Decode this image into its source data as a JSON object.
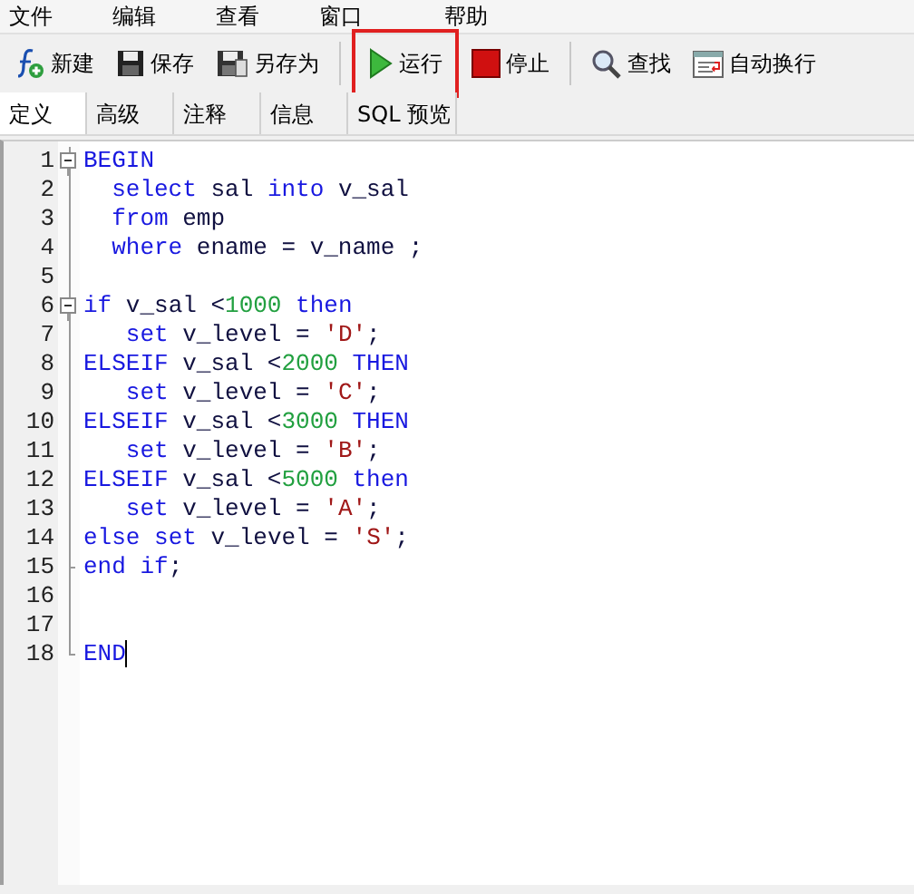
{
  "menu": [
    "文件",
    "编辑",
    "查看",
    "窗口",
    "帮助"
  ],
  "toolbar": {
    "groups": [
      [
        {
          "label": "新建",
          "kind": "new",
          "highlighted": false
        },
        {
          "label": "保存",
          "kind": "save",
          "highlighted": false
        },
        {
          "label": "另存为",
          "kind": "saveas",
          "highlighted": false
        }
      ],
      [
        {
          "label": "运行",
          "kind": "run",
          "highlighted": true
        },
        {
          "label": "停止",
          "kind": "stop",
          "highlighted": false
        }
      ],
      [
        {
          "label": "查找",
          "kind": "search",
          "highlighted": false
        },
        {
          "label": "自动换行",
          "kind": "wrap",
          "highlighted": false
        }
      ]
    ]
  },
  "tabs": [
    {
      "label": "定义",
      "selected": true
    },
    {
      "label": "高级",
      "selected": false
    },
    {
      "label": "注释",
      "selected": false
    },
    {
      "label": "信息",
      "selected": false
    },
    {
      "label": "SQL 预览",
      "selected": false
    }
  ],
  "editor": {
    "lines": [
      {
        "number": "1",
        "kind": "start",
        "tokens": [
          {
            "kind": "kw",
            "text": "BEGIN"
          }
        ]
      },
      {
        "number": "2",
        "kind": "body",
        "tokens": [
          {
            "kind": "kw",
            "text": "  select"
          },
          {
            "kind": "plain",
            "text": " sal "
          },
          {
            "kind": "kw",
            "text": "into"
          },
          {
            "kind": "plain",
            "text": " v_sal"
          }
        ]
      },
      {
        "number": "3",
        "kind": "body",
        "tokens": [
          {
            "kind": "kw",
            "text": "  from"
          },
          {
            "kind": "plain",
            "text": " emp"
          }
        ]
      },
      {
        "number": "4",
        "kind": "body",
        "tokens": [
          {
            "kind": "kw",
            "text": "  where"
          },
          {
            "kind": "plain",
            "text": " ename = v_name ;"
          }
        ]
      },
      {
        "number": "5",
        "kind": "body"
      },
      {
        "number": "6",
        "kind": "start",
        "tokens": [
          {
            "kind": "kw",
            "text": "if"
          },
          {
            "kind": "plain",
            "text": " v_sal <"
          },
          {
            "kind": "num",
            "text": "1000"
          },
          {
            "kind": "kw",
            "text": " then"
          }
        ]
      },
      {
        "number": "7",
        "kind": "body",
        "tokens": [
          {
            "kind": "kw",
            "text": "   set"
          },
          {
            "kind": "plain",
            "text": " v_level = "
          },
          {
            "kind": "str",
            "text": "'D'"
          },
          {
            "kind": "plain",
            "text": ";"
          }
        ]
      },
      {
        "number": "8",
        "kind": "body",
        "tokens": [
          {
            "kind": "kw",
            "text": "ELSEIF"
          },
          {
            "kind": "plain",
            "text": " v_sal <"
          },
          {
            "kind": "num",
            "text": "2000"
          },
          {
            "kind": "kw",
            "text": " THEN"
          }
        ]
      },
      {
        "number": "9",
        "kind": "body",
        "tokens": [
          {
            "kind": "kw",
            "text": "   set"
          },
          {
            "kind": "plain",
            "text": " v_level = "
          },
          {
            "kind": "str",
            "text": "'C'"
          },
          {
            "kind": "plain",
            "text": ";"
          }
        ]
      },
      {
        "number": "10",
        "kind": "body",
        "tokens": [
          {
            "kind": "kw",
            "text": "ELSEIF"
          },
          {
            "kind": "plain",
            "text": " v_sal <"
          },
          {
            "kind": "num",
            "text": "3000"
          },
          {
            "kind": "kw",
            "text": " THEN"
          }
        ]
      },
      {
        "number": "11",
        "kind": "body",
        "tokens": [
          {
            "kind": "kw",
            "text": "   set"
          },
          {
            "kind": "plain",
            "text": " v_level = "
          },
          {
            "kind": "str",
            "text": "'B'"
          },
          {
            "kind": "plain",
            "text": ";"
          }
        ]
      },
      {
        "number": "12",
        "kind": "body",
        "tokens": [
          {
            "kind": "kw",
            "text": "ELSEIF"
          },
          {
            "kind": "plain",
            "text": " v_sal <"
          },
          {
            "kind": "num",
            "text": "5000"
          },
          {
            "kind": "kw",
            "text": " then"
          }
        ]
      },
      {
        "number": "13",
        "kind": "body",
        "tokens": [
          {
            "kind": "kw",
            "text": "   set"
          },
          {
            "kind": "plain",
            "text": " v_level = "
          },
          {
            "kind": "str",
            "text": "'A'"
          },
          {
            "kind": "plain",
            "text": ";"
          }
        ]
      },
      {
        "number": "14",
        "kind": "body",
        "tokens": [
          {
            "kind": "kw",
            "text": "else"
          },
          {
            "kind": "kw",
            "text": " set"
          },
          {
            "kind": "plain",
            "text": " v_level = "
          },
          {
            "kind": "str",
            "text": "'S'"
          },
          {
            "kind": "plain",
            "text": ";"
          }
        ]
      },
      {
        "number": "15",
        "kind": "end",
        "tokens": [
          {
            "kind": "kw",
            "text": "end"
          },
          {
            "kind": "kw",
            "text": " if"
          },
          {
            "kind": "plain",
            "text": ";"
          }
        ]
      },
      {
        "number": "16",
        "kind": "body"
      },
      {
        "number": "17",
        "kind": "body"
      },
      {
        "number": "18",
        "kind": "end",
        "tokens": [
          {
            "kind": "kw",
            "text": "END"
          }
        ]
      }
    ]
  }
}
